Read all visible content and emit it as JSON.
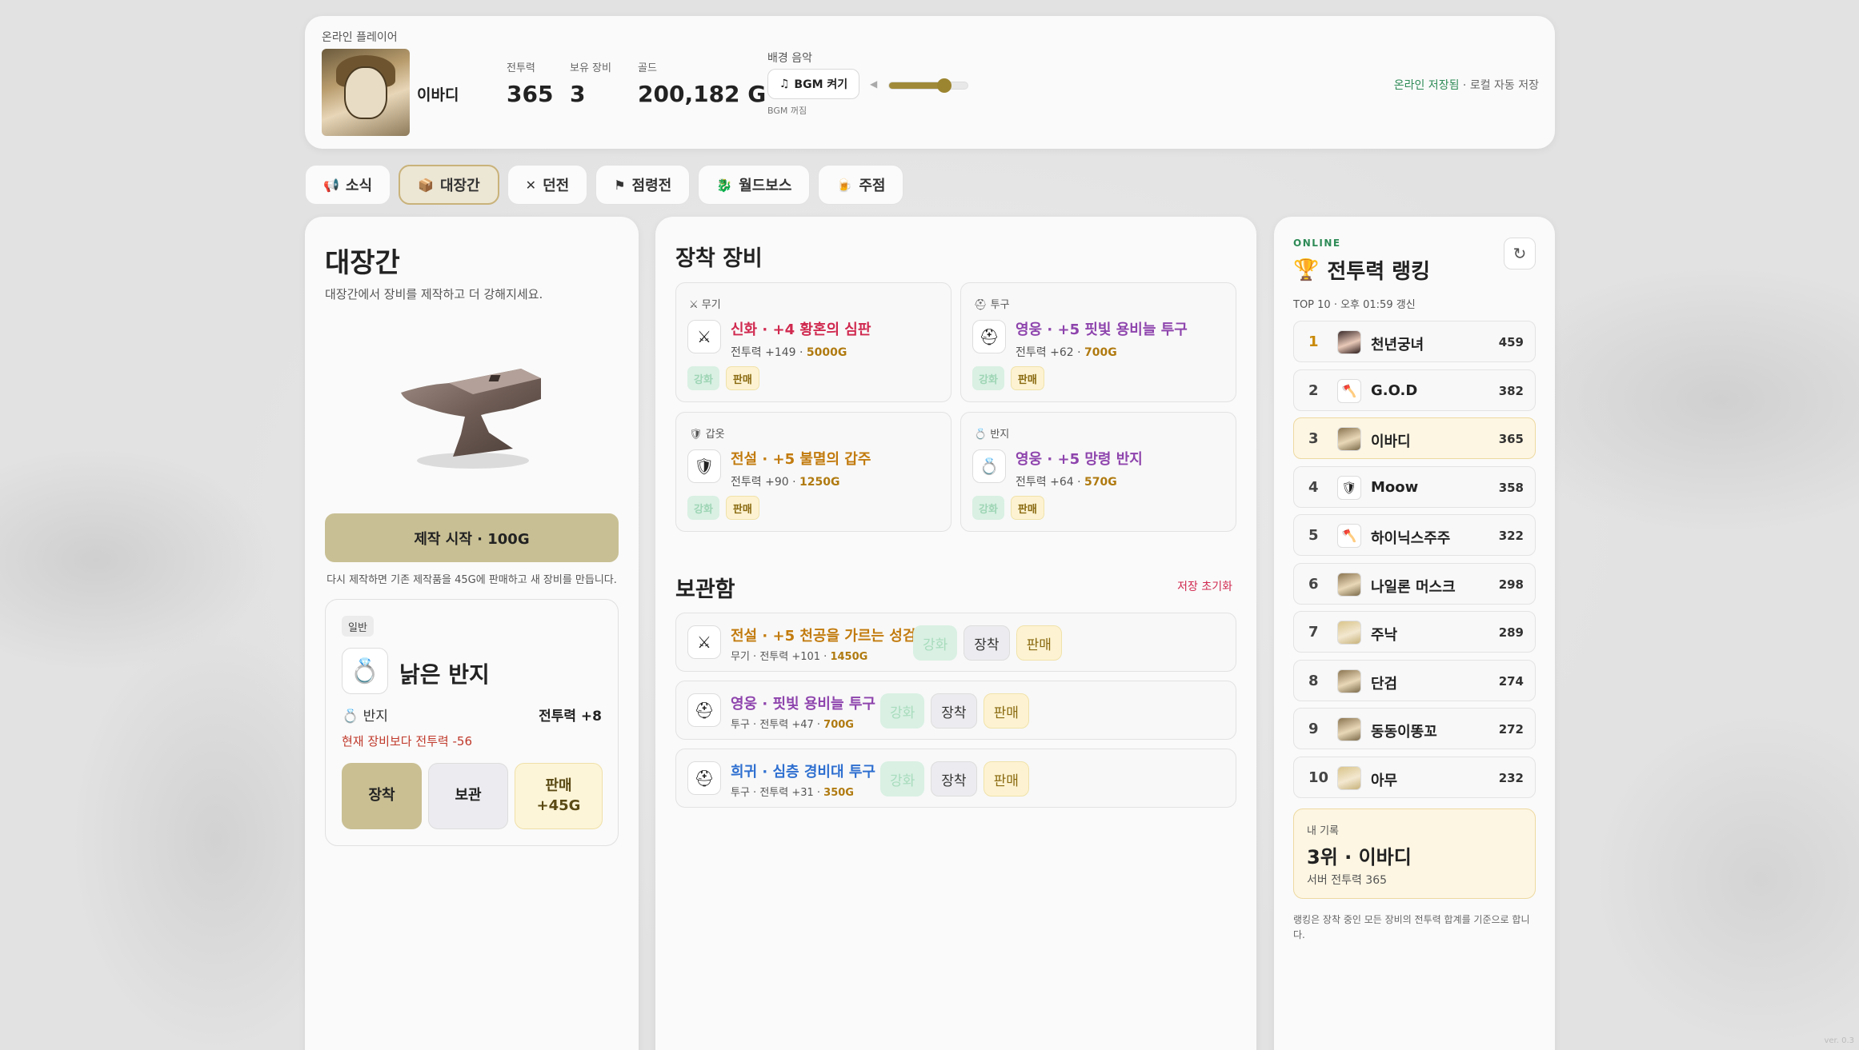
{
  "header": {
    "online_player_label": "온라인 플레이어",
    "player_name": "이바디",
    "stats": [
      {
        "label": "전투력",
        "value": "365"
      },
      {
        "label": "보유 장비",
        "value": "3"
      },
      {
        "label": "골드",
        "value": "200,182 G"
      }
    ],
    "bgm": {
      "label": "배경 음악",
      "button": "BGM 켜기",
      "status": "BGM 꺼짐",
      "volume": 0.7
    },
    "save": {
      "online": "온라인 저장됨",
      "sep": "·",
      "local": "로컬 자동 저장"
    }
  },
  "tabs": [
    {
      "icon": "📢",
      "label": "소식",
      "active": false
    },
    {
      "icon": "📦",
      "label": "대장간",
      "active": true
    },
    {
      "icon": "✕",
      "label": "던전",
      "active": false
    },
    {
      "icon": "⚑",
      "label": "점령전",
      "active": false
    },
    {
      "icon": "🐉",
      "label": "월드보스",
      "active": false
    },
    {
      "icon": "🍺",
      "label": "주점",
      "active": false
    }
  ],
  "forge": {
    "title": "대장간",
    "subtitle": "대장간에서 장비를 제작하고 더 강해지세요.",
    "craft_button": "제작 시작 · 100G",
    "craft_note": "다시 제작하면 기존 제작품을 45G에 판매하고 새 장비를 만듭니다.",
    "item": {
      "grade": "일반",
      "icon": "💍",
      "name": "낡은 반지",
      "slot_icon": "💍",
      "slot": "반지",
      "power": "전투력 +8",
      "compare": "현재 장비보다 전투력 -56",
      "equip": "장착",
      "store": "보관",
      "sell": "판매",
      "sell_price": "+45G"
    }
  },
  "equipment": {
    "title": "장착 장비",
    "enhance_label": "강화",
    "sell_label": "판매",
    "slots": [
      {
        "slot_icon": "⚔",
        "slot": "무기",
        "icon": "⚔",
        "name": "신화 · +4 황혼의 심판",
        "grade": "myth",
        "power": "전투력 +149 · ",
        "price": "5000G"
      },
      {
        "slot_icon": "⛑",
        "slot": "투구",
        "icon": "⛑",
        "name": "영웅 · +5 핏빛 용비늘 투구",
        "grade": "hero",
        "power": "전투력 +62 · ",
        "price": "700G"
      },
      {
        "slot_icon": "🛡",
        "slot": "갑옷",
        "icon": "🛡",
        "name": "전설 · +5 불멸의 갑주",
        "grade": "leg",
        "power": "전투력 +90 · ",
        "price": "1250G"
      },
      {
        "slot_icon": "💍",
        "slot": "반지",
        "icon": "💍",
        "name": "영웅 · +5 망령 반지",
        "grade": "hero",
        "power": "전투력 +64 · ",
        "price": "570G"
      }
    ]
  },
  "storage": {
    "title": "보관함",
    "reset": "저장 초기화",
    "enhance_label": "강화",
    "equip_label": "장착",
    "sell_label": "판매",
    "items": [
      {
        "icon": "⚔",
        "name": "전설 · +5 천공을 가르는 성검",
        "grade": "leg",
        "meta": "무기 · 전투력 +101 · ",
        "price": "1450G"
      },
      {
        "icon": "⛑",
        "name": "영웅 · 핏빛 용비늘 투구",
        "grade": "hero",
        "meta": "투구 · 전투력 +47 · ",
        "price": "700G"
      },
      {
        "icon": "⛑",
        "name": "희귀 · 심층 경비대 투구",
        "grade": "rare",
        "meta": "투구 · 전투력 +31 · ",
        "price": "350G"
      }
    ]
  },
  "ranking": {
    "online": "ONLINE",
    "title_icon": "🏆",
    "title": "전투력 랭킹",
    "refresh_icon": "↻",
    "subtitle": "TOP 10 · 오후 01:59 갱신",
    "rows": [
      {
        "rank": "1",
        "name": "천년궁녀",
        "score": "459",
        "pic": "dark",
        "icon": ""
      },
      {
        "rank": "2",
        "name": "G.O.D",
        "score": "382",
        "pic": "",
        "icon": "🪓"
      },
      {
        "rank": "3",
        "name": "이바디",
        "score": "365",
        "pic": "face",
        "icon": "",
        "me": true
      },
      {
        "rank": "4",
        "name": "Moow",
        "score": "358",
        "pic": "",
        "icon": "🛡"
      },
      {
        "rank": "5",
        "name": "하이닉스주주",
        "score": "322",
        "pic": "",
        "icon": "🪓"
      },
      {
        "rank": "6",
        "name": "나일론 머스크",
        "score": "298",
        "pic": "face",
        "icon": ""
      },
      {
        "rank": "7",
        "name": "주낙",
        "score": "289",
        "pic": "blonde",
        "icon": ""
      },
      {
        "rank": "8",
        "name": "단검",
        "score": "274",
        "pic": "face",
        "icon": ""
      },
      {
        "rank": "9",
        "name": "동동이똥꼬",
        "score": "272",
        "pic": "face",
        "icon": ""
      },
      {
        "rank": "10",
        "name": "아무",
        "score": "232",
        "pic": "blonde",
        "icon": ""
      }
    ],
    "my_record": {
      "label": "내 기록",
      "rank_name": "3위 · 이바디",
      "server_power": "서버 전투력 365"
    },
    "note": "랭킹은 장착 중인 모든 장비의 전투력 합계를 기준으로 합니다."
  },
  "version": "ver. 0.3"
}
